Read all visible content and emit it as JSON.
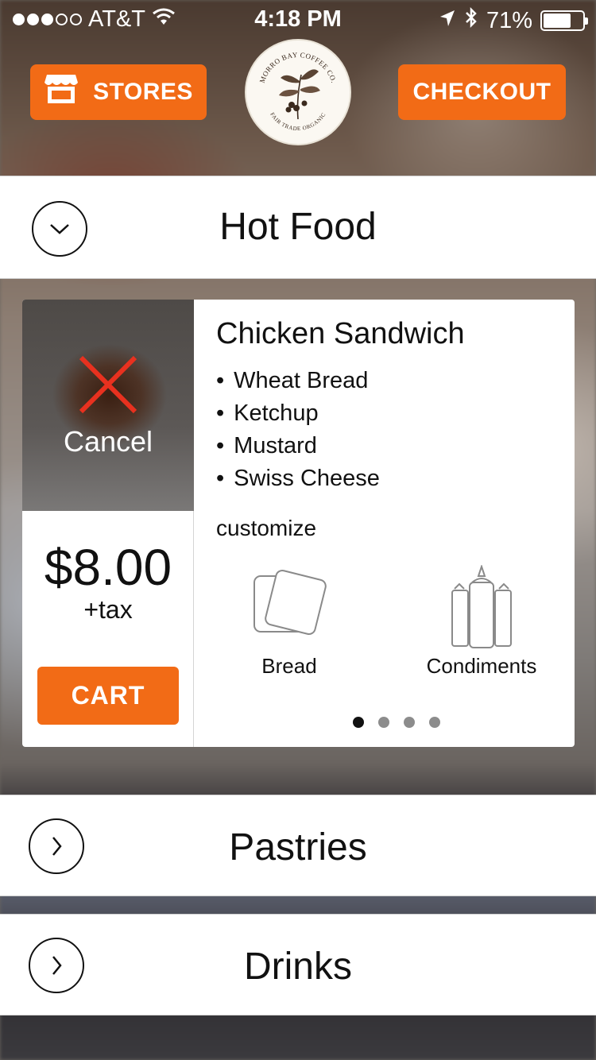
{
  "status_bar": {
    "carrier": "AT&T",
    "time": "4:18 PM",
    "battery": "71%",
    "battery_level": 0.71,
    "signal_bars": 3,
    "signal_total": 5,
    "icons": [
      "wifi-icon",
      "location-arrow-icon",
      "bluetooth-icon",
      "battery-icon"
    ]
  },
  "header": {
    "stores_label": "STORES",
    "checkout_label": "CHECKOUT",
    "logo": {
      "top_text": "MORRO BAY COFFEE CO.",
      "bottom_text": "FAIR TRADE ORGANIC"
    }
  },
  "categories": [
    {
      "title": "Hot Food",
      "expanded": true
    },
    {
      "title": "Pastries",
      "expanded": false
    },
    {
      "title": "Drinks",
      "expanded": false
    }
  ],
  "item": {
    "cancel_label": "Cancel",
    "name": "Chicken Sandwich",
    "ingredients": [
      "Wheat Bread",
      "Ketchup",
      "Mustard",
      "Swiss Cheese"
    ],
    "customize_label": "customize",
    "options": [
      {
        "label": "Bread",
        "icon": "bread-icon"
      },
      {
        "label": "Condiments",
        "icon": "condiments-icon"
      }
    ],
    "price": "$8.00",
    "tax_note": "+tax",
    "cart_label": "CART",
    "pager": {
      "pages": 4,
      "active": 1
    }
  },
  "colors": {
    "accent": "#f26b16",
    "cancel_x": "#e8311f"
  }
}
